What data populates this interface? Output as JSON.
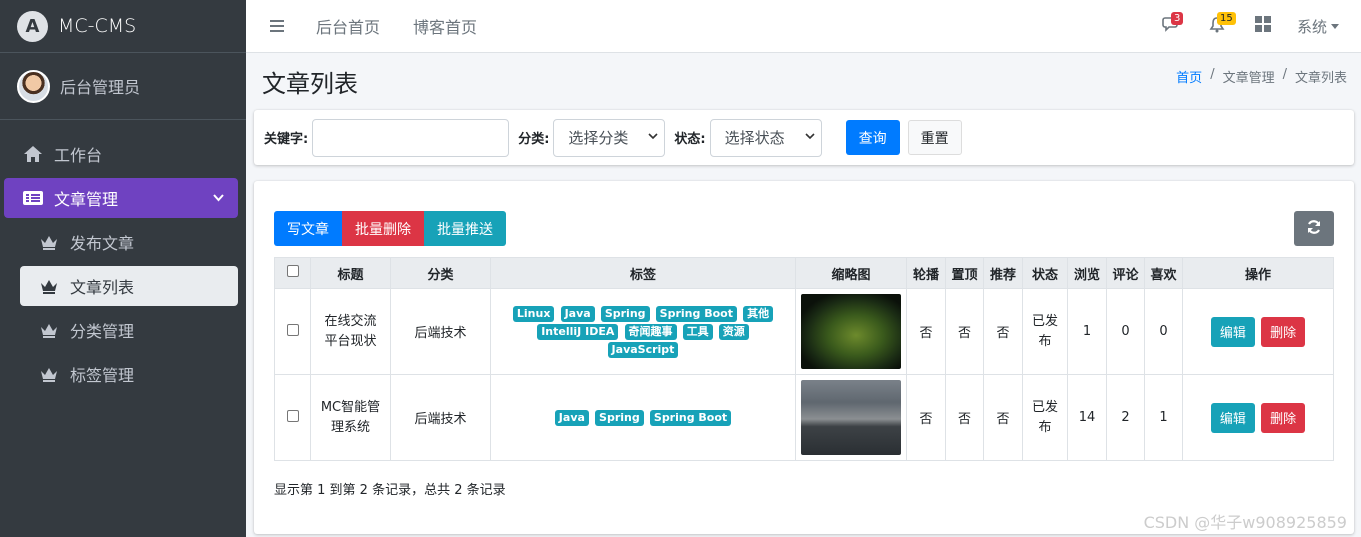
{
  "brand": {
    "logo_letter": "A",
    "name": "MC-CMS"
  },
  "user": {
    "name": "后台管理员"
  },
  "sidebar": {
    "items": [
      {
        "label": "工作台",
        "icon": "home-icon"
      },
      {
        "label": "文章管理",
        "icon": "list-icon",
        "active": true,
        "expanded": true
      }
    ],
    "sub_items": [
      {
        "label": "发布文章",
        "icon": "crown-icon"
      },
      {
        "label": "文章列表",
        "icon": "crown-icon",
        "active": true
      },
      {
        "label": "分类管理",
        "icon": "crown-icon"
      },
      {
        "label": "标签管理",
        "icon": "crown-icon"
      }
    ]
  },
  "navbar": {
    "links": [
      "后台首页",
      "博客首页"
    ],
    "messages_count": "3",
    "notifications_count": "15",
    "system_label": "系统"
  },
  "page": {
    "title": "文章列表",
    "breadcrumb": [
      "首页",
      "文章管理",
      "文章列表"
    ]
  },
  "search": {
    "keyword_label": "关键字:",
    "keyword_value": "",
    "category_label": "分类:",
    "category_value": "选择分类",
    "status_label": "状态:",
    "status_value": "选择状态",
    "query_button": "查询",
    "reset_button": "重置"
  },
  "toolbar": {
    "write_button": "写文章",
    "batch_delete_button": "批量删除",
    "batch_push_button": "批量推送"
  },
  "table": {
    "headers": [
      "标题",
      "分类",
      "标签",
      "缩略图",
      "轮播",
      "置顶",
      "推荐",
      "状态",
      "浏览",
      "评论",
      "喜欢",
      "操作"
    ],
    "rows": [
      {
        "title": "在线交流平台现状",
        "category": "后端技术",
        "tags": [
          "Linux",
          "Java",
          "Spring",
          "Spring Boot",
          "其他",
          "IntelliJ IDEA",
          "奇闻趣事",
          "工具",
          "资源",
          "JavaScript"
        ],
        "carousel": "否",
        "top": "否",
        "recommend": "否",
        "status": "已发布",
        "views": "1",
        "comments": "0",
        "likes": "0",
        "edit": "编辑",
        "delete": "删除"
      },
      {
        "title": "MC智能管理系统",
        "category": "后端技术",
        "tags": [
          "Java",
          "Spring",
          "Spring Boot"
        ],
        "carousel": "否",
        "top": "否",
        "recommend": "否",
        "status": "已发布",
        "views": "14",
        "comments": "2",
        "likes": "1",
        "edit": "编辑",
        "delete": "删除"
      }
    ]
  },
  "pagination": {
    "summary": "显示第 1 到第 2 条记录，总共 2 条记录"
  },
  "watermark": "CSDN @华子w908925859",
  "colors": {
    "sidebar": "#343a40",
    "active_nav": "#6f42c1",
    "primary": "#007bff",
    "danger": "#dc3545",
    "info": "#17a2b8"
  }
}
